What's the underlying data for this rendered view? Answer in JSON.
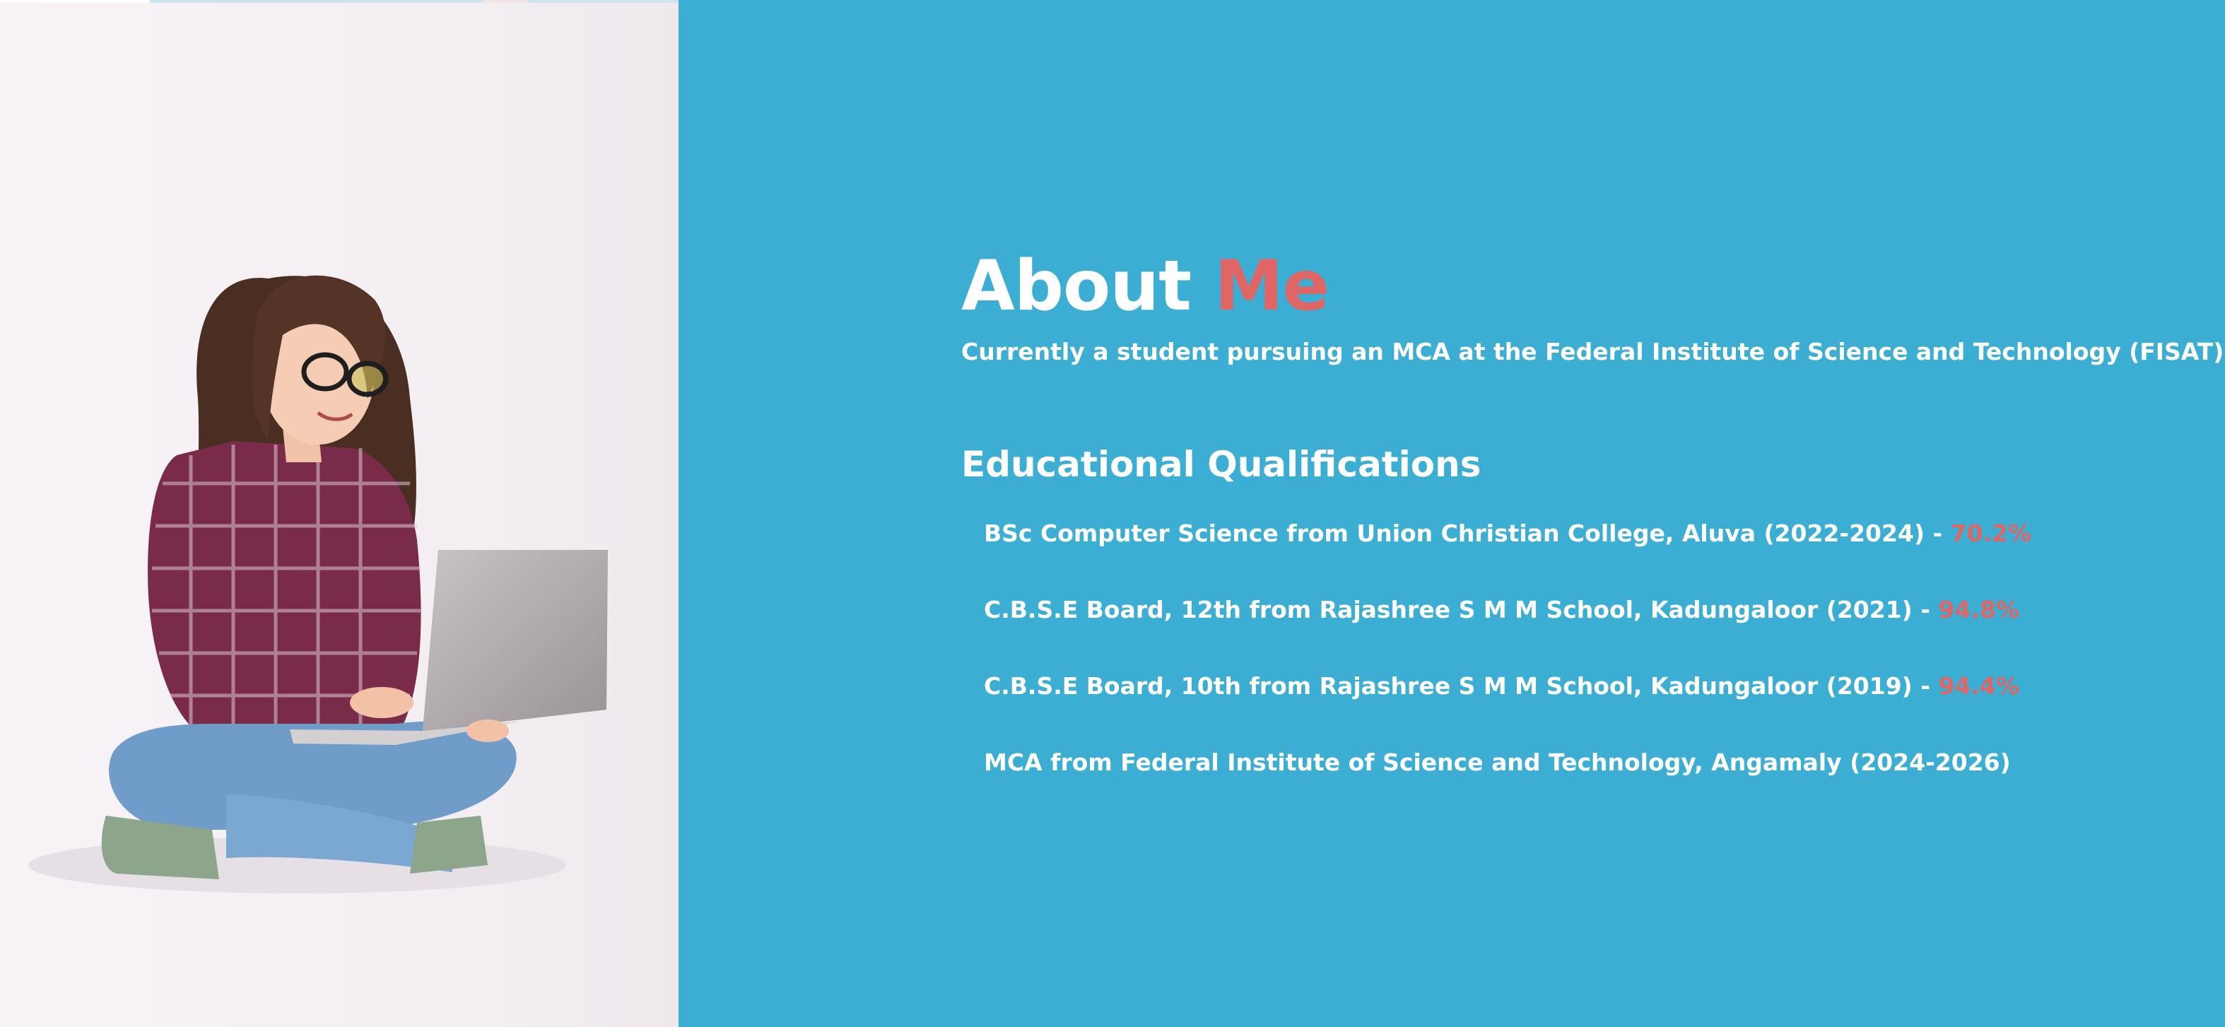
{
  "colors": {
    "background": "#3caed4",
    "accent": "#e06666",
    "text": "#ffffff"
  },
  "images": {
    "profile_photo": "student-with-laptop-photo"
  },
  "about": {
    "title_main": "About",
    "title_accent": "Me",
    "intro": "Currently a student pursuing an MCA at the Federal Institute of Science and Technology (FISAT)."
  },
  "education": {
    "heading": "Educational Qualifications",
    "items": [
      {
        "text": "BSc Computer Science from Union Christian College, Aluva (2022-2024) - ",
        "score": "70.2%"
      },
      {
        "text": "C.B.S.E Board, 12th from Rajashree S M M School, Kadungaloor (2021) - ",
        "score": "94.8%"
      },
      {
        "text": "C.B.S.E Board, 10th from Rajashree S M M School, Kadungaloor (2019) - ",
        "score": "94.4%"
      },
      {
        "text": "MCA from Federal Institute of Science and Technology, Angamaly (2024-2026)",
        "score": ""
      }
    ]
  }
}
